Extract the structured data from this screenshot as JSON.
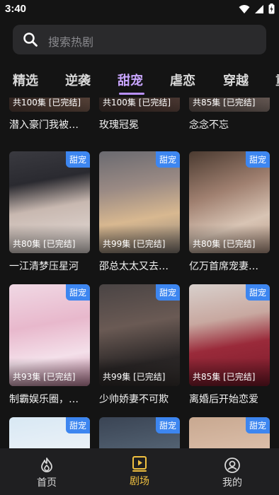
{
  "status": {
    "time": "3:40"
  },
  "search": {
    "placeholder": "搜索热剧"
  },
  "tabs": [
    {
      "label": "精选"
    },
    {
      "label": "逆袭"
    },
    {
      "label": "甜宠"
    },
    {
      "label": "虐恋"
    },
    {
      "label": "穿越"
    },
    {
      "label": "重"
    }
  ],
  "active_tab": "甜宠",
  "dramas": [
    {
      "title": "潜入豪门我被…",
      "episodes": "共100集 [已完结]",
      "tag": ""
    },
    {
      "title": "玫瑰冠冕",
      "episodes": "共100集 [已完结]",
      "tag": ""
    },
    {
      "title": "念念不忘",
      "episodes": "共85集 [已完结]",
      "tag": ""
    },
    {
      "title": "一江清梦压星河",
      "episodes": "共80集 [已完结]",
      "tag": "甜宠"
    },
    {
      "title": "邵总太太又去…",
      "episodes": "共99集 [已完结]",
      "tag": "甜宠"
    },
    {
      "title": "亿万首席宠妻…",
      "episodes": "共80集 [已完结]",
      "tag": "甜宠"
    },
    {
      "title": "制霸娱乐圈，…",
      "episodes": "共93集 [已完结]",
      "tag": "甜宠"
    },
    {
      "title": "少帅娇妻不可欺",
      "episodes": "共99集 [已完结]",
      "tag": "甜宠"
    },
    {
      "title": "离婚后开始恋爱",
      "episodes": "共85集 [已完结]",
      "tag": "甜宠"
    },
    {
      "title": "",
      "episodes": "",
      "tag": "甜宠"
    },
    {
      "title": "",
      "episodes": "",
      "tag": "甜宠"
    },
    {
      "title": "",
      "episodes": "",
      "tag": "甜宠"
    }
  ],
  "bottom_nav": [
    {
      "label": "首页",
      "icon": "flame-icon"
    },
    {
      "label": "剧场",
      "icon": "play-icon"
    },
    {
      "label": "我的",
      "icon": "user-icon"
    }
  ],
  "colors": {
    "accent_tab": "#c9a6ff",
    "tag_blue": "#3d86f0",
    "nav_active": "#f0c040"
  }
}
